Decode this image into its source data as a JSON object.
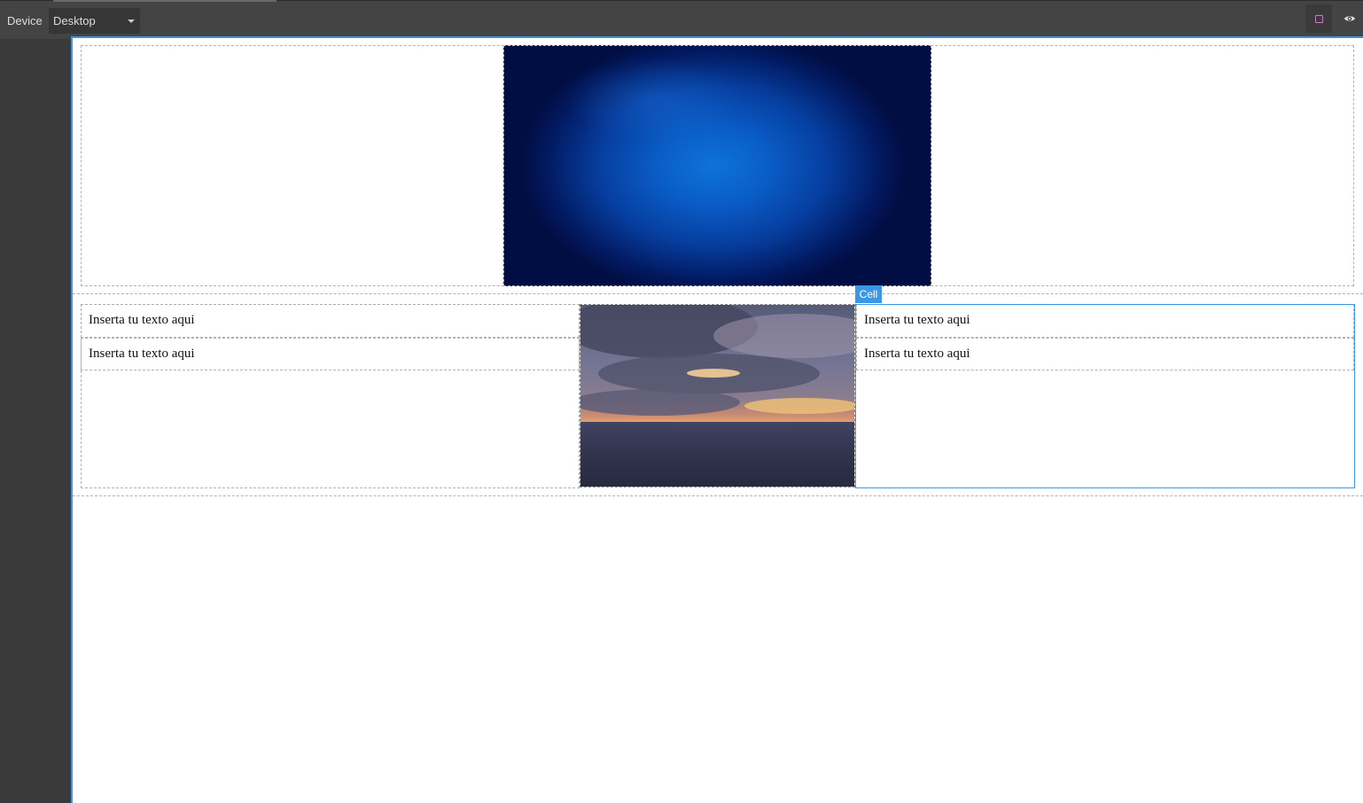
{
  "toolbar": {
    "device_label": "Device",
    "device_value": "Desktop",
    "icons": [
      "square-outline-icon",
      "eye-icon"
    ],
    "accent_color": "#d278c9"
  },
  "canvas": {
    "selection_badge": "Cell",
    "selection_color": "#3b97e3",
    "left_texts": [
      "Inserta tu texto aqui",
      "Inserta tu texto aqui"
    ],
    "right_texts": [
      "Inserta tu texto aqui",
      "Inserta tu texto aqui"
    ]
  }
}
